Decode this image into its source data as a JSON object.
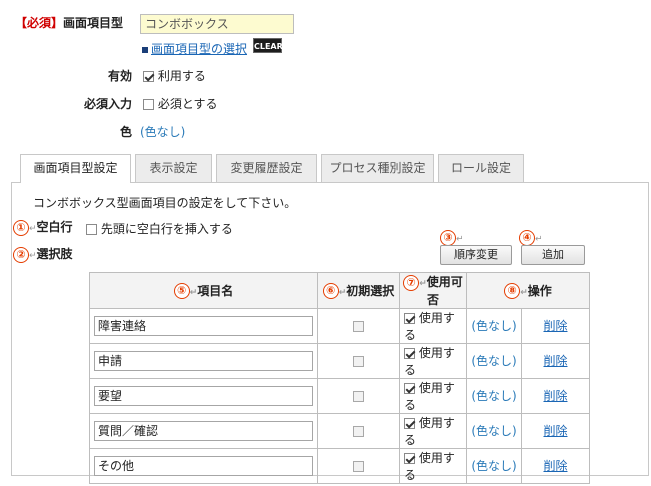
{
  "form": {
    "required_tag": "【必須】",
    "item_type_label": "画面項目型",
    "item_type_value": "コンボボックス",
    "select_link": "画面項目型の選択",
    "clear_button": "CLEAR",
    "enabled_label": "有効",
    "enabled_checkbox_label": "利用する",
    "enabled_checked": true,
    "required_input_label": "必須入力",
    "required_checkbox_label": "必須とする",
    "required_checked": false,
    "color_label": "色",
    "color_value": "(色なし)"
  },
  "tabs": [
    {
      "label": "画面項目型設定",
      "active": true
    },
    {
      "label": "表示設定",
      "active": false
    },
    {
      "label": "変更履歴設定",
      "active": false
    },
    {
      "label": "プロセス種別設定",
      "active": false
    },
    {
      "label": "ロール設定",
      "active": false
    }
  ],
  "panel": {
    "description": "コンボボックス型画面項目の設定をして下さい。",
    "blank_row_label": "空白行",
    "blank_row_checkbox_label": "先頭に空白行を挿入する",
    "blank_row_checked": false,
    "choices_label": "選択肢",
    "reorder_button": "順序変更",
    "add_button": "追加"
  },
  "annotations": {
    "n1": "①",
    "n2": "②",
    "n3": "③",
    "n4": "④",
    "n5": "⑤",
    "n6": "⑥",
    "n7": "⑦",
    "n8": "⑧",
    "return_mark": "↵"
  },
  "table": {
    "headers": {
      "item_name": "項目名",
      "initial_select": "初期選択",
      "usable": "使用可否",
      "operation": "操作"
    },
    "rows": [
      {
        "name": "障害連絡",
        "initial": false,
        "use": true,
        "use_label": "使用する",
        "color": "(色なし)",
        "delete": "削除"
      },
      {
        "name": "申請",
        "initial": false,
        "use": true,
        "use_label": "使用する",
        "color": "(色なし)",
        "delete": "削除"
      },
      {
        "name": "要望",
        "initial": false,
        "use": true,
        "use_label": "使用する",
        "color": "(色なし)",
        "delete": "削除"
      },
      {
        "name": "質問／確認",
        "initial": false,
        "use": true,
        "use_label": "使用する",
        "color": "(色なし)",
        "delete": "削除"
      },
      {
        "name": "その他",
        "initial": false,
        "use": true,
        "use_label": "使用する",
        "color": "(色なし)",
        "delete": "削除"
      }
    ]
  },
  "colors": {
    "required": "#d00000",
    "link": "#1a66b5",
    "annotation": "#e53d00",
    "input_bg": "#fdfbd0"
  }
}
